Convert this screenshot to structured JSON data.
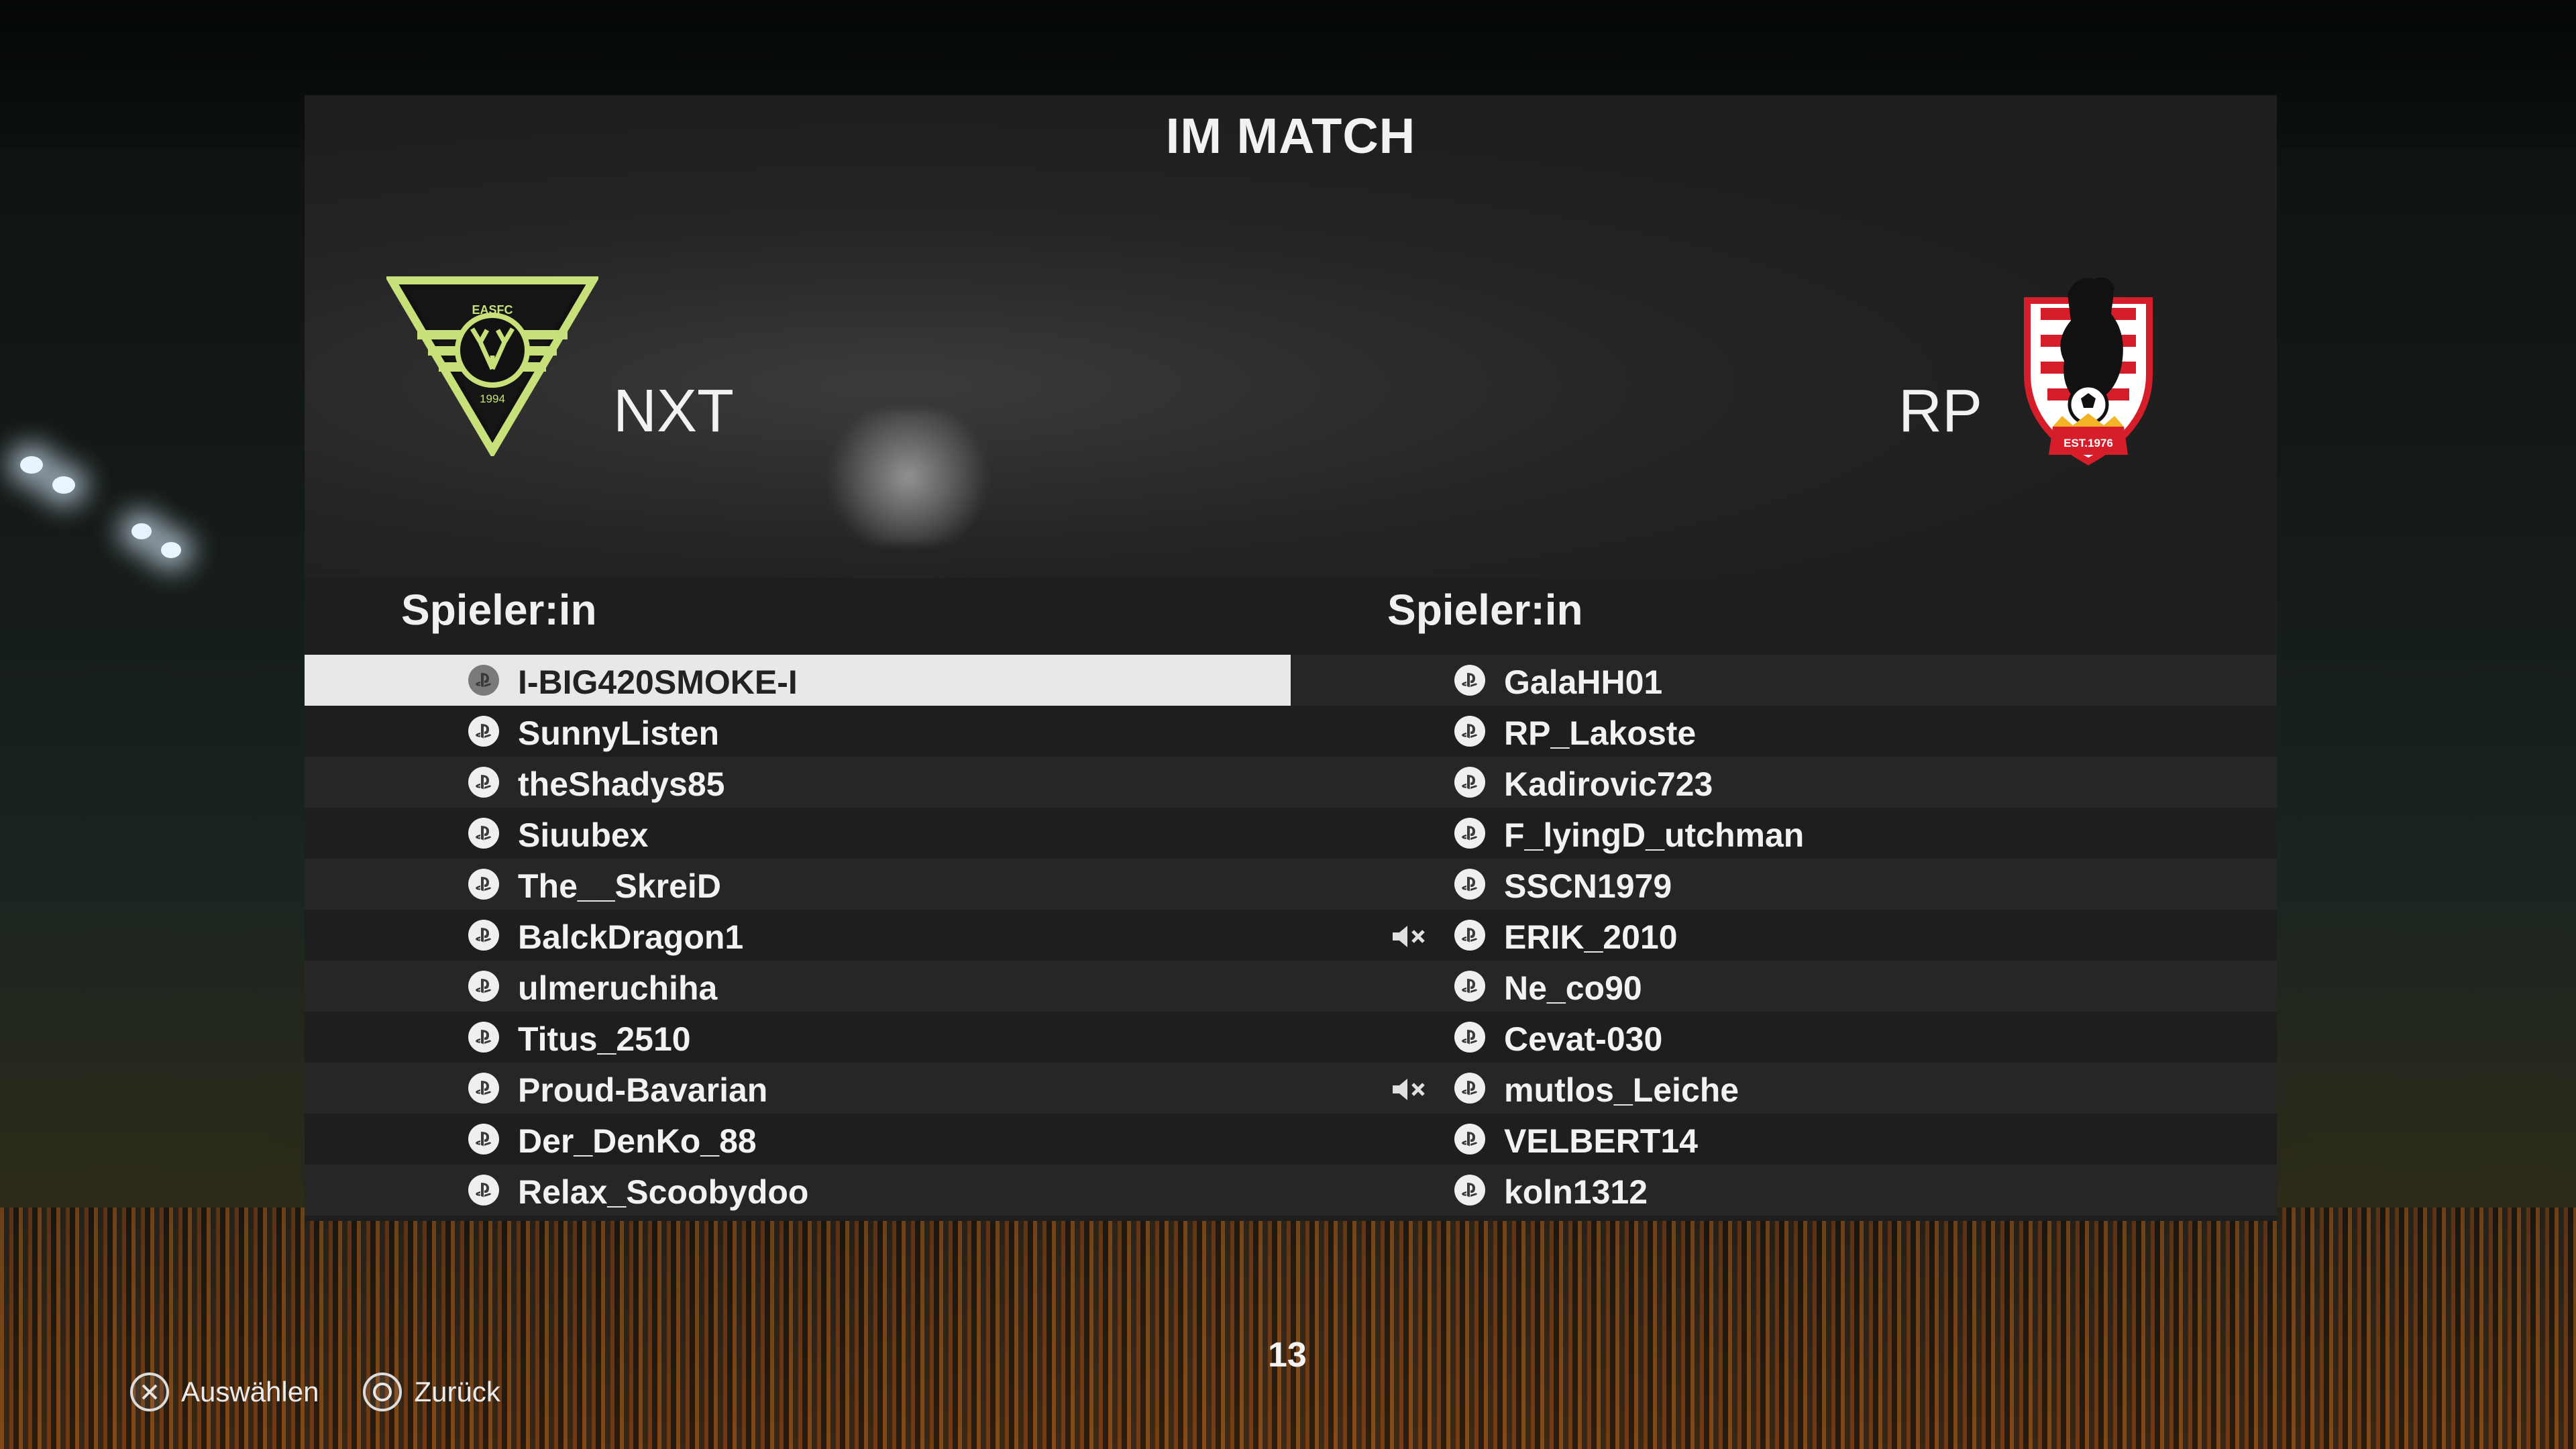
{
  "screen": {
    "title": "IM MATCH"
  },
  "teams": {
    "home": {
      "name": "NXT",
      "crest_text_top": "EASFC",
      "crest_text_bottom": "1994"
    },
    "away": {
      "name": "RP",
      "crest_text": "EST.1976"
    }
  },
  "columns": {
    "home_header": "Spieler:in",
    "away_header": "Spieler:in"
  },
  "home_players": [
    {
      "name": "I-BIG420SMOKE-I",
      "selected": true,
      "muted": false
    },
    {
      "name": "SunnyListen",
      "selected": false,
      "muted": false
    },
    {
      "name": "theShadys85",
      "selected": false,
      "muted": false
    },
    {
      "name": "Siuubex",
      "selected": false,
      "muted": false
    },
    {
      "name": "The__SkreiD",
      "selected": false,
      "muted": false
    },
    {
      "name": "BalckDragon1",
      "selected": false,
      "muted": false
    },
    {
      "name": "ulmeruchiha",
      "selected": false,
      "muted": false
    },
    {
      "name": "Titus_2510",
      "selected": false,
      "muted": false
    },
    {
      "name": "Proud-Bavarian",
      "selected": false,
      "muted": false
    },
    {
      "name": "Der_DenKo_88",
      "selected": false,
      "muted": false
    },
    {
      "name": "Relax_Scoobydoo",
      "selected": false,
      "muted": false
    }
  ],
  "away_players": [
    {
      "name": "GalaHH01",
      "muted": false
    },
    {
      "name": "RP_Lakoste",
      "muted": false
    },
    {
      "name": "Kadirovic723",
      "muted": false
    },
    {
      "name": "F_lyingD_utchman",
      "muted": false
    },
    {
      "name": "SSCN1979",
      "muted": false
    },
    {
      "name": "ERIK_2010",
      "muted": true
    },
    {
      "name": "Ne_co90",
      "muted": false
    },
    {
      "name": "Cevat-030",
      "muted": false
    },
    {
      "name": "mutlos_Leiche",
      "muted": true
    },
    {
      "name": "VELBERT14",
      "muted": false
    },
    {
      "name": "koln1312",
      "muted": false
    }
  ],
  "page_number": "13",
  "footer": {
    "select_label": "Auswählen",
    "back_label": "Zurück"
  },
  "icons": {
    "platform": "playstation-icon",
    "mute": "speaker-muted-icon",
    "select": "cross-button-icon",
    "back": "circle-button-icon"
  },
  "colors": {
    "panel": "#1e1e1e",
    "row_alt": "#262626",
    "selected_row": "#e8e8e8",
    "home_crest": "#c8e07a"
  }
}
